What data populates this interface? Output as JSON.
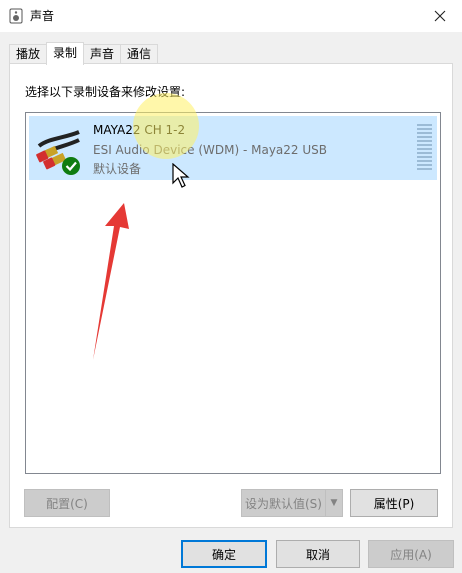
{
  "window": {
    "title": "声音"
  },
  "tabs": [
    {
      "label": "播放",
      "active": false
    },
    {
      "label": "录制",
      "active": true
    },
    {
      "label": "声音",
      "active": false
    },
    {
      "label": "通信",
      "active": false
    }
  ],
  "recording": {
    "instruction": "选择以下录制设备来修改设置:",
    "devices": [
      {
        "name": "MAYA22 CH 1-2",
        "description": "ESI Audio Device (WDM) - Maya22 USB",
        "status": "默认设备",
        "selected": true
      }
    ],
    "buttons": {
      "configure": "配置(C)",
      "set_default": "设为默认值(S)",
      "properties": "属性(P)"
    }
  },
  "footer": {
    "ok": "确定",
    "cancel": "取消",
    "apply": "应用(A)"
  },
  "colors": {
    "selection": "#cce8ff",
    "accent": "#0078d7",
    "annotation_arrow": "#e53935",
    "check": "#107c10"
  }
}
